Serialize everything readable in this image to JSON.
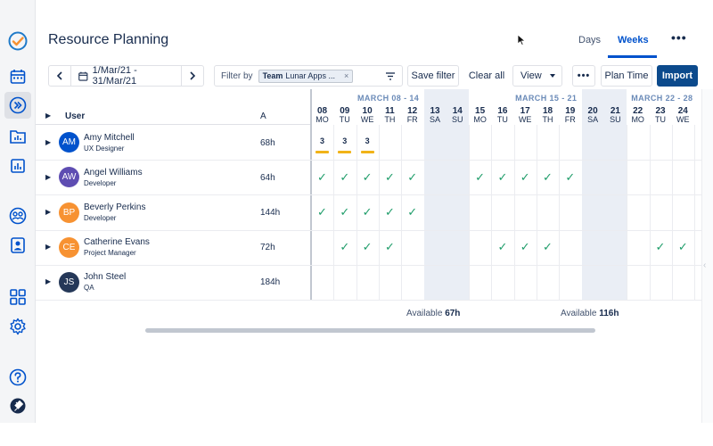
{
  "header": {
    "title": "Resource Planning",
    "tabs": [
      {
        "label": "Days",
        "active": false
      },
      {
        "label": "Weeks",
        "active": true
      }
    ],
    "more": "•••"
  },
  "toolbar": {
    "date_range": "1/Mar/21 - 31/Mar/21",
    "filter_label": "Filter by",
    "filter_chip_key": "Team",
    "filter_chip_value": "Lunar Apps ...",
    "filter_chip_remove": "×",
    "save_filter": "Save filter",
    "clear_all": "Clear all",
    "view": "View",
    "more": "•••",
    "plan_time": "Plan Time",
    "import": "Import"
  },
  "grid": {
    "col_user": "User",
    "col_a": "A",
    "weeks": [
      "MARCH 08 - 14",
      "MARCH 15 - 21",
      "MARCH 22 - 28"
    ],
    "days": [
      {
        "num": "08",
        "name": "MO",
        "weekend": false
      },
      {
        "num": "09",
        "name": "TU",
        "weekend": false
      },
      {
        "num": "10",
        "name": "WE",
        "weekend": false
      },
      {
        "num": "11",
        "name": "TH",
        "weekend": false
      },
      {
        "num": "12",
        "name": "FR",
        "weekend": false
      },
      {
        "num": "13",
        "name": "SA",
        "weekend": true
      },
      {
        "num": "14",
        "name": "SU",
        "weekend": true
      },
      {
        "num": "15",
        "name": "MO",
        "weekend": false
      },
      {
        "num": "16",
        "name": "TU",
        "weekend": false
      },
      {
        "num": "17",
        "name": "WE",
        "weekend": false
      },
      {
        "num": "18",
        "name": "TH",
        "weekend": false
      },
      {
        "num": "19",
        "name": "FR",
        "weekend": false
      },
      {
        "num": "20",
        "name": "SA",
        "weekend": true
      },
      {
        "num": "21",
        "name": "SU",
        "weekend": true
      },
      {
        "num": "22",
        "name": "MO",
        "weekend": false
      },
      {
        "num": "23",
        "name": "TU",
        "weekend": false
      },
      {
        "num": "24",
        "name": "WE",
        "weekend": false
      }
    ],
    "users": [
      {
        "initials": "AM",
        "name": "Amy Mitchell",
        "role": "UX Designer",
        "hours": "68h",
        "color": "#0052cc",
        "cells": [
          "3",
          "3",
          "3",
          "",
          "",
          "",
          "",
          "",
          "",
          "",
          "",
          "",
          "",
          "",
          "",
          "",
          ""
        ]
      },
      {
        "initials": "AW",
        "name": "Angel Williams",
        "role": "Developer",
        "hours": "64h",
        "color": "#5e4db2",
        "cells": [
          "✓",
          "✓",
          "✓",
          "✓",
          "✓",
          "",
          "",
          "✓",
          "✓",
          "✓",
          "✓",
          "✓",
          "",
          "",
          "",
          "",
          ""
        ]
      },
      {
        "initials": "BP",
        "name": "Beverly Perkins",
        "role": "Developer",
        "hours": "144h",
        "color": "#f79232",
        "cells": [
          "✓",
          "✓",
          "✓",
          "✓",
          "✓",
          "",
          "",
          "",
          "",
          "",
          "",
          "",
          "",
          "",
          "",
          "",
          ""
        ]
      },
      {
        "initials": "CE",
        "name": "Catherine Evans",
        "role": "Project Manager",
        "hours": "72h",
        "color": "#f79232",
        "cells": [
          "",
          "✓",
          "✓",
          "✓",
          "",
          "",
          "",
          "",
          "✓",
          "✓",
          "✓",
          "",
          "",
          "",
          "",
          "✓",
          "✓"
        ]
      },
      {
        "initials": "JS",
        "name": "John Steel",
        "role": "QA",
        "hours": "184h",
        "color": "#253858",
        "cells": [
          "",
          "",
          "",
          "",
          "",
          "",
          "",
          "",
          "",
          "",
          "",
          "",
          "",
          "",
          "",
          "",
          ""
        ]
      }
    ]
  },
  "footer": {
    "available_label": "Available",
    "week1_available": "67h",
    "week2_available": "116h"
  }
}
